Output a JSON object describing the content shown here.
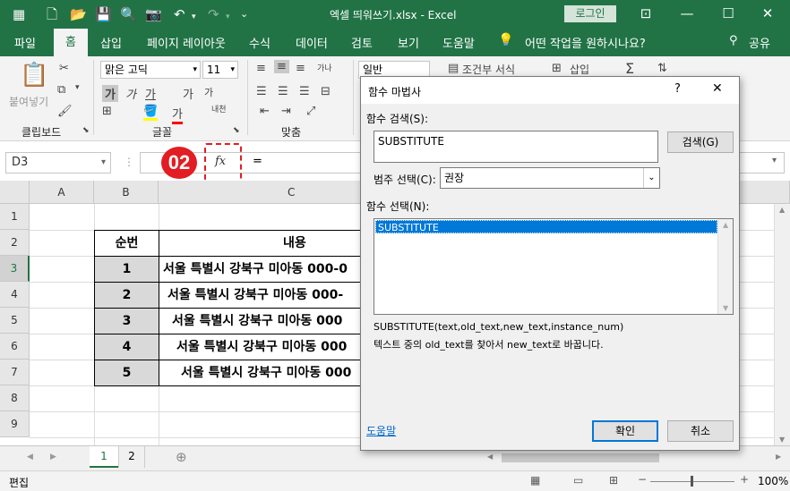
{
  "titlebar": {
    "title": "엑셀 띄워쓰기.xlsx  -  Excel",
    "signin": "로그인"
  },
  "tabs": [
    "파일",
    "홈",
    "삽입",
    "페이지 레이아웃",
    "수식",
    "데이터",
    "검토",
    "보기",
    "도움말"
  ],
  "tell_me": "어떤 작업을 원하시나요?",
  "share": "공유",
  "ribbon": {
    "paste": "붙여넣기",
    "clipboard": "클립보드",
    "font_name": "맑은 고딕",
    "font_size": "11",
    "font_group": "글꼴",
    "align_group": "맞춤",
    "number_format": "일반",
    "cond_format": "조건부 서식",
    "insert": "삽입",
    "bold": "가",
    "italic": "가",
    "underline": "가",
    "grow": "가",
    "shrink": "가",
    "font_color": "가",
    "wrap_text": "가나",
    "merge": "내천"
  },
  "formula_bar": {
    "namebox": "D3",
    "fx": "fx",
    "formula": "=",
    "badge": "02"
  },
  "grid": {
    "columns": [
      "A",
      "B",
      "C"
    ],
    "rows": [
      "1",
      "2",
      "3",
      "4",
      "5",
      "6",
      "7",
      "8",
      "9"
    ],
    "header_seq": "순번",
    "header_content": "내용",
    "data": [
      {
        "seq": "1",
        "content": "서울 특별시 강북구 미아동 000-0"
      },
      {
        "seq": "2",
        "content": "서울 특별시 강북구 미아동 000-"
      },
      {
        "seq": "3",
        "content": "서울 특별시 강북구 미아동 000"
      },
      {
        "seq": "4",
        "content": "서울 특별시 강북구 미아동 000"
      },
      {
        "seq": "5",
        "content": "서울 특별시 강북구 미아동 000"
      }
    ]
  },
  "sheets": [
    "1",
    "2"
  ],
  "status": {
    "mode": "편집",
    "zoom": "100%"
  },
  "dialog": {
    "title": "함수 마법사",
    "help_glyph": "?",
    "search_label": "함수 검색(S):",
    "search_value": "SUBSTITUTE",
    "search_button": "검색(G)",
    "category_label": "범주 선택(C):",
    "category_value": "권장",
    "function_label": "함수 선택(N):",
    "functions": [
      "SUBSTITUTE"
    ],
    "signature": "SUBSTITUTE(text,old_text,new_text,instance_num)",
    "description": "텍스트 중의 old_text를 찾아서 new_text로 바꿉니다.",
    "help_link": "도움말",
    "ok": "확인",
    "cancel": "취소"
  },
  "colors": {
    "excel_green": "#217346",
    "highlight_red": "#e21d23",
    "selection_blue": "#0078d7"
  }
}
